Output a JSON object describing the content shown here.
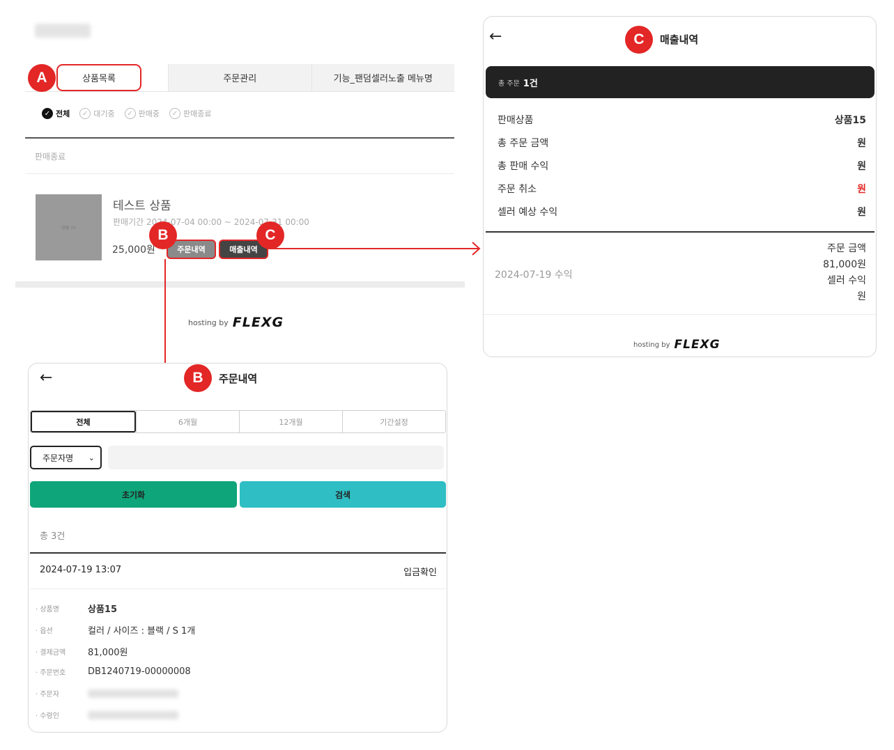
{
  "main": {
    "tabs": [
      {
        "label": "상품목록"
      },
      {
        "label": "주문관리"
      },
      {
        "label": "기능_팬덤셀러노출 메뉴명"
      }
    ],
    "filters": [
      {
        "label": "전체",
        "checked": true
      },
      {
        "label": "대기중",
        "checked": false
      },
      {
        "label": "판매중",
        "checked": false
      },
      {
        "label": "판매종료",
        "checked": false
      }
    ],
    "section_label": "판매종료",
    "product": {
      "thumb_text": "상품 15",
      "name": "테스트 상품",
      "period": "판매기간 2024-07-04 00:00 ~ 2024-07-31 00:00",
      "price": "25,000원",
      "order_button": "주문내역",
      "sales_button": "매출내역"
    },
    "hosting_text": "hosting by",
    "hosting_logo": "FLEXG"
  },
  "badges": {
    "a": "A",
    "b": "B",
    "c": "C"
  },
  "sales_panel": {
    "title": "매출내역",
    "total_small": "총 주문",
    "total_count": "1건",
    "rows": [
      {
        "label": "판매상품",
        "value": "상품15"
      },
      {
        "label": "총 주문 금액",
        "value": "원"
      },
      {
        "label": "총 판매 수익",
        "value": "원"
      },
      {
        "label": "주문 취소",
        "value": "원"
      },
      {
        "label": "셀러 예상 수익",
        "value": "원"
      }
    ],
    "revenue_date": "2024-07-19 수익",
    "revenue_lines": [
      "주문 금액",
      "81,000원",
      "셀러 수익",
      "원"
    ],
    "hosting_text": "hosting by",
    "hosting_logo": "FLEXG"
  },
  "order_panel": {
    "title": "주문내역",
    "periods": [
      "전체",
      "6개월",
      "12개월",
      "기간설정"
    ],
    "select_value": "주문자명",
    "reset_button": "초기화",
    "search_button": "검색",
    "total": "총 3건",
    "order_date": "2024-07-19 13:07",
    "order_status": "입금확인",
    "details": [
      {
        "label": "· 상품명",
        "value": "상품15"
      },
      {
        "label": "· 옵션",
        "value": "컬러 / 사이즈 : 블랙 / S 1개"
      },
      {
        "label": "· 결제금액",
        "value": "81,000원"
      },
      {
        "label": "· 주문번호",
        "value": "DB1240719-00000008"
      },
      {
        "label": "· 주문자",
        "value": ""
      },
      {
        "label": "· 수령인",
        "value": ""
      }
    ]
  },
  "colors": {
    "accent_red": "#e32626",
    "reset_green": "#0fa57a",
    "search_teal": "#2ebec4",
    "dark_bar": "#222222"
  }
}
